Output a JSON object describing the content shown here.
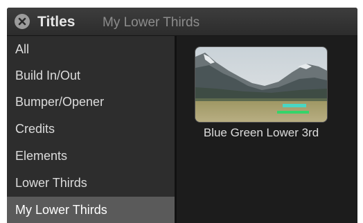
{
  "header": {
    "title": "Titles",
    "subtitle": "My Lower Thirds",
    "close_icon": "close-circle-icon"
  },
  "sidebar": {
    "items": [
      {
        "label": "All",
        "selected": false
      },
      {
        "label": "Build In/Out",
        "selected": false
      },
      {
        "label": "Bumper/Opener",
        "selected": false
      },
      {
        "label": "Credits",
        "selected": false
      },
      {
        "label": "Elements",
        "selected": false
      },
      {
        "label": "Lower Thirds",
        "selected": false
      },
      {
        "label": "My Lower Thirds",
        "selected": true
      }
    ]
  },
  "content": {
    "items": [
      {
        "name": "Blue Green Lower 3rd"
      }
    ]
  },
  "colors": {
    "background": "#1c1c1c",
    "sidebar": "#2d2d2d",
    "selected": "#5a5a5a",
    "accent_cyan": "#49d6c4",
    "accent_green": "#35d46a"
  }
}
